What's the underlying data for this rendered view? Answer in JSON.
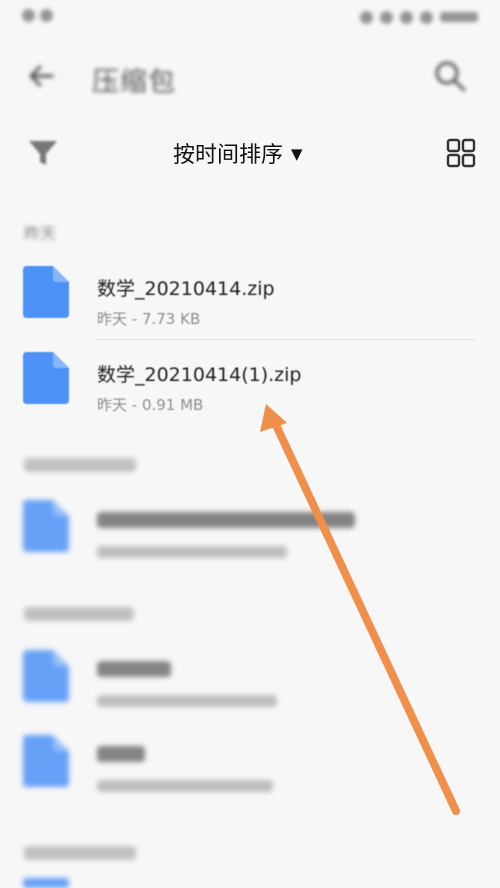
{
  "header": {
    "title": "压缩包"
  },
  "toolbar": {
    "sort_label": "按时间排序",
    "sort_caret": "▼"
  },
  "sections": [
    {
      "label": "昨天",
      "files": [
        {
          "name": "数学_20210414.zip",
          "meta": "昨天 - 7.73 KB"
        },
        {
          "name": "数学_20210414(1).zip",
          "meta": "昨天 - 0.91 MB"
        }
      ]
    }
  ],
  "colors": {
    "accent_file": "#4d92f7",
    "arrow": "#f08f4a",
    "background": "#f7f7f7"
  },
  "icons": {
    "back": "arrow-left-icon",
    "search": "search-icon",
    "filter": "filter-icon",
    "grid": "grid-view-icon",
    "file": "file-icon"
  }
}
